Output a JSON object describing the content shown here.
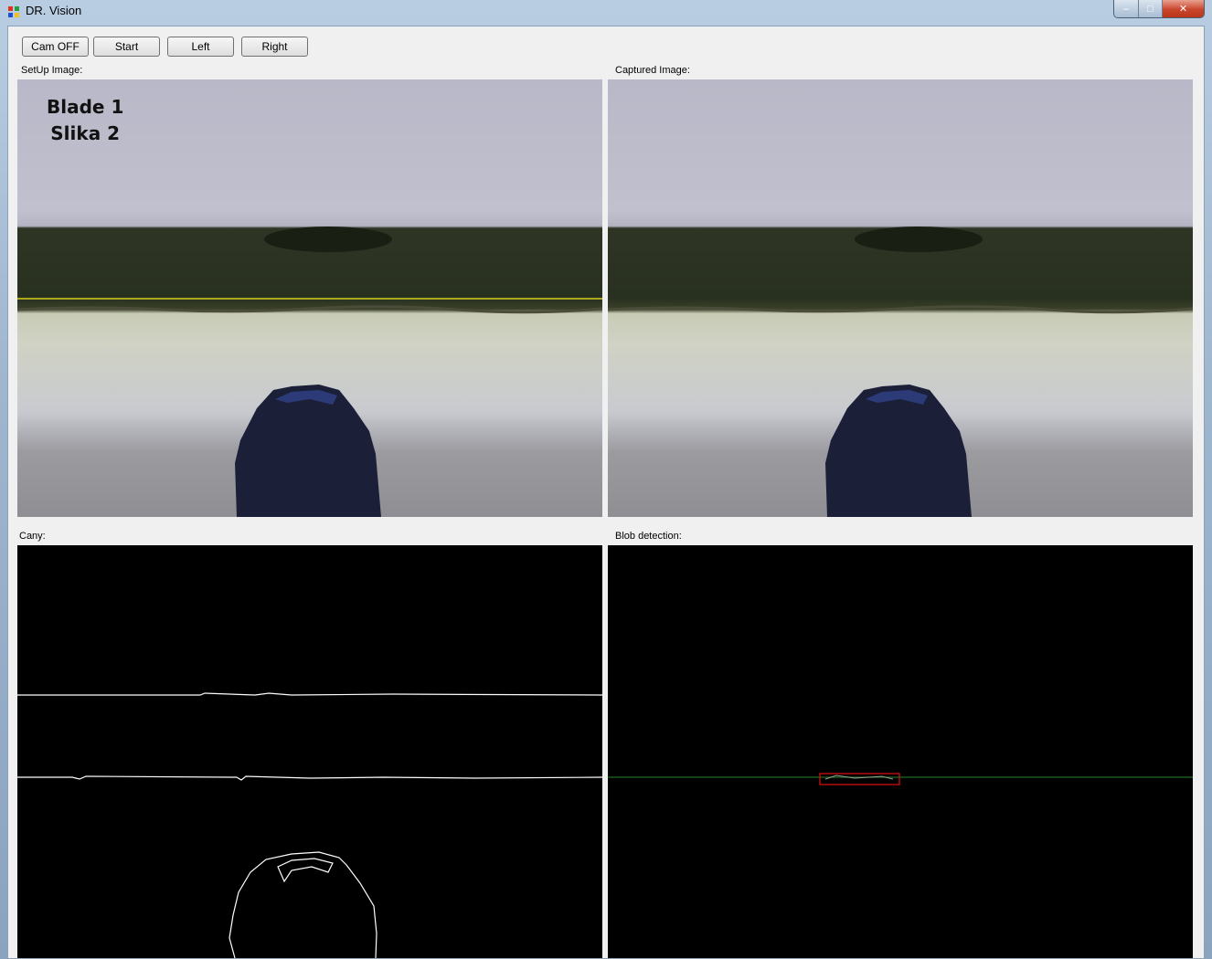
{
  "window": {
    "title": "DR. Vision",
    "controls": {
      "minimize": "‒",
      "maximize": "□",
      "close": "✕"
    }
  },
  "toolbar": {
    "cam_label": "Cam OFF",
    "start_label": "Start",
    "left_label": "Left",
    "right_label": "Right"
  },
  "panels": {
    "setup": {
      "label": "SetUp Image:",
      "overlay_line1": "Blade 1",
      "overlay_line2": "Slika 2"
    },
    "captured": {
      "label": "Captured Image:"
    },
    "canny": {
      "label": "Cany:"
    },
    "blob": {
      "label": "Blob detection:"
    }
  },
  "colors": {
    "reference_line": "#d7d01a",
    "edge_line": "#ffffff",
    "blob_line": "#1f6b1f",
    "blob_box": "#e01010"
  }
}
